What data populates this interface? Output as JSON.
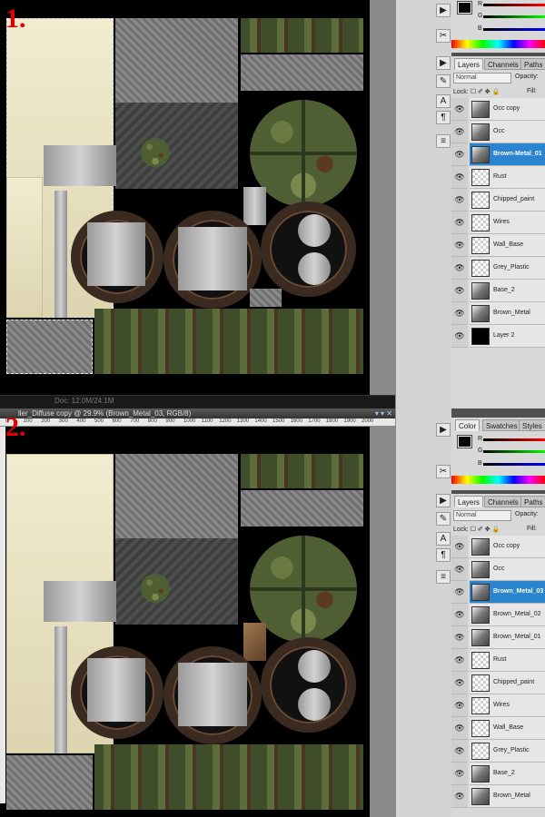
{
  "panel1": {
    "number": "1.",
    "status_text": "Doc: 12.0M/24.1M",
    "color_panel": {
      "channels": [
        "R",
        "G",
        "B"
      ]
    },
    "layers_panel": {
      "tabs": [
        "Layers",
        "Channels",
        "Paths"
      ],
      "blend_mode": "Normal",
      "opacity_label": "Opacity:",
      "lock_label": "Lock:",
      "fill_label": "Fill:",
      "layers": [
        {
          "name": "Occ copy",
          "selected": false
        },
        {
          "name": "Occ",
          "selected": false
        },
        {
          "name": "Brown-Metal_01",
          "selected": true
        },
        {
          "name": "Rust",
          "selected": false
        },
        {
          "name": "Chipped_paint",
          "selected": false
        },
        {
          "name": "Wires",
          "selected": false
        },
        {
          "name": "Wall_Base",
          "selected": false
        },
        {
          "name": "Grey_Plastic",
          "selected": false
        },
        {
          "name": "Base_2",
          "selected": false
        },
        {
          "name": "Brown_Metal",
          "selected": false
        },
        {
          "name": "Layer 2",
          "selected": false
        }
      ]
    }
  },
  "panel2": {
    "number": "2.",
    "doc_title": "ller_Diffuse copy @ 29.9% (Brown_Metal_03, RGB/8)",
    "ruler_ticks": [
      "0",
      "100",
      "200",
      "300",
      "400",
      "500",
      "600",
      "700",
      "800",
      "900",
      "1000",
      "1100",
      "1200",
      "1300",
      "1400",
      "1500",
      "1600",
      "1700",
      "1800",
      "1900",
      "2000"
    ],
    "color_panel": {
      "tabs": [
        "Color",
        "Swatches",
        "Styles"
      ],
      "channels": [
        "R",
        "G",
        "B"
      ]
    },
    "layers_panel": {
      "tabs": [
        "Layers",
        "Channels",
        "Paths"
      ],
      "blend_mode": "Normal",
      "opacity_label": "Opacity:",
      "lock_label": "Lock:",
      "fill_label": "Fill:",
      "layers": [
        {
          "name": "Occ copy",
          "selected": false
        },
        {
          "name": "Occ",
          "selected": false
        },
        {
          "name": "Brown_Metal_03",
          "selected": true
        },
        {
          "name": "Brown_Metal_02",
          "selected": false
        },
        {
          "name": "Brown_Metal_01",
          "selected": false
        },
        {
          "name": "Rust",
          "selected": false
        },
        {
          "name": "Chipped_paint",
          "selected": false
        },
        {
          "name": "Wires",
          "selected": false
        },
        {
          "name": "Wall_Base",
          "selected": false
        },
        {
          "name": "Grey_Plastic",
          "selected": false
        },
        {
          "name": "Base_2",
          "selected": false
        },
        {
          "name": "Brown_Metal",
          "selected": false
        }
      ]
    }
  },
  "colors": {
    "selection_blue": "#2a84d0",
    "number_red": "#e00000",
    "canvas_bg": "#000000"
  }
}
